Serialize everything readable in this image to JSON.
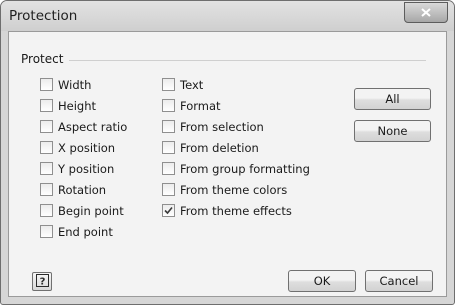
{
  "window": {
    "title": "Protection",
    "close_icon": "close-icon"
  },
  "protect_group": {
    "label": "Protect",
    "left_column": [
      {
        "label": "Width",
        "checked": false
      },
      {
        "label": "Height",
        "checked": false
      },
      {
        "label": "Aspect ratio",
        "checked": false
      },
      {
        "label": "X position",
        "checked": false
      },
      {
        "label": "Y position",
        "checked": false
      },
      {
        "label": "Rotation",
        "checked": false
      },
      {
        "label": "Begin point",
        "checked": false
      },
      {
        "label": "End point",
        "checked": false
      }
    ],
    "right_column": [
      {
        "label": "Text",
        "checked": false
      },
      {
        "label": "Format",
        "checked": false
      },
      {
        "label": "From selection",
        "checked": false
      },
      {
        "label": "From deletion",
        "checked": false
      },
      {
        "label": "From group formatting",
        "checked": false
      },
      {
        "label": "From theme colors",
        "checked": false
      },
      {
        "label": "From theme effects",
        "checked": true
      }
    ]
  },
  "buttons": {
    "all": "All",
    "none": "None",
    "ok": "OK",
    "cancel": "Cancel",
    "help_icon": "help-icon"
  }
}
